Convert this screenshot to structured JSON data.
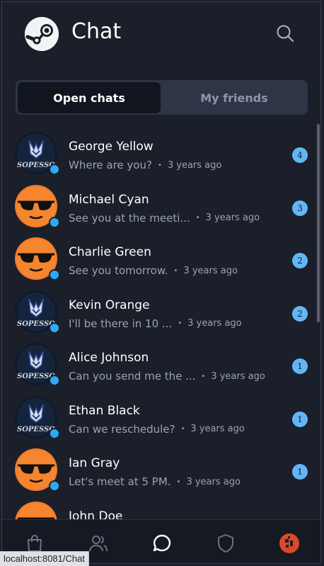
{
  "header": {
    "title": "Chat",
    "logo_icon": "steam-logo-icon",
    "search_icon": "search-icon"
  },
  "tabs": [
    {
      "label": "Open chats",
      "active": true
    },
    {
      "label": "My friends",
      "active": false
    }
  ],
  "chats": [
    {
      "name": "George Yellow",
      "message": "Where are you?",
      "time": "3 years ago",
      "unread": "4",
      "avatar": "sopesso"
    },
    {
      "name": "Michael Cyan",
      "message": "See you at the meeti...",
      "time": "3 years ago",
      "unread": "3",
      "avatar": "sunglasses"
    },
    {
      "name": "Charlie Green",
      "message": "See you tomorrow.",
      "time": "3 years ago",
      "unread": "2",
      "avatar": "sunglasses"
    },
    {
      "name": "Kevin Orange",
      "message": "I'll be there in 10 ...",
      "time": "3 years ago",
      "unread": "2",
      "avatar": "sopesso"
    },
    {
      "name": "Alice Johnson",
      "message": "Can you send me the ...",
      "time": "3 years ago",
      "unread": "1",
      "avatar": "sopesso"
    },
    {
      "name": "Ethan Black",
      "message": "Can we reschedule?",
      "time": "3 years ago",
      "unread": "1",
      "avatar": "sopesso"
    },
    {
      "name": "Ian Gray",
      "message": "Let's meet at 5 PM.",
      "time": "3 years ago",
      "unread": "1",
      "avatar": "sunglasses"
    },
    {
      "name": "John Doe",
      "message": "",
      "time": "",
      "unread": "",
      "avatar": "sunglasses"
    }
  ],
  "bottom_nav": [
    {
      "icon": "shopping-bag-icon"
    },
    {
      "icon": "friends-icon"
    },
    {
      "icon": "chat-bubble-icon",
      "active": true
    },
    {
      "icon": "shield-icon"
    },
    {
      "icon": "profile-avatar-icon"
    }
  ],
  "status_bar": {
    "url": "localhost:8081/Chat"
  },
  "colors": {
    "background": "#1b1f2a",
    "accent": "#63b6f5",
    "online": "#2ea9f5",
    "tab_active": "#11151d",
    "tab_bar": "#2d3547"
  }
}
